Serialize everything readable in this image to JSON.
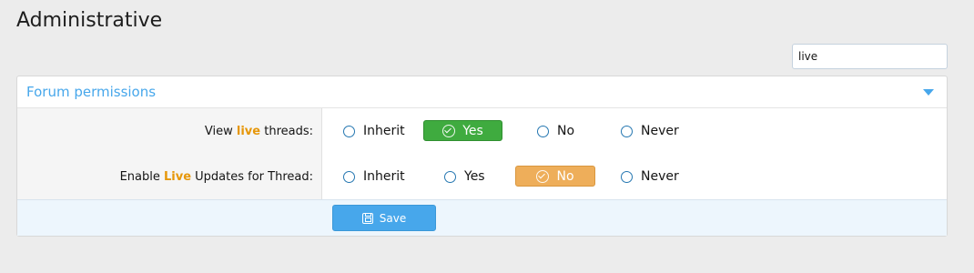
{
  "page": {
    "title": "Administrative"
  },
  "filter": {
    "value": "live"
  },
  "block": {
    "title": "Forum permissions",
    "rows": [
      {
        "label_pre": "View ",
        "label_hl": "live",
        "label_post": " threads:",
        "options": [
          "Inherit",
          "Yes",
          "No",
          "Never"
        ],
        "selected": "Yes"
      },
      {
        "label_pre": "Enable ",
        "label_hl": "Live",
        "label_post": " Updates for Thread:",
        "options": [
          "Inherit",
          "Yes",
          "No",
          "Never"
        ],
        "selected": "No"
      }
    ]
  },
  "actions": {
    "save_label": "Save"
  },
  "colors": {
    "accent": "#47a7eb",
    "highlight": "#e6970a",
    "yes_selected": "#3fab3f",
    "no_selected": "#eeae5a"
  },
  "icons": {
    "collapse": "chevron-down-icon",
    "selected": "check-circle-icon",
    "save": "save-icon"
  }
}
